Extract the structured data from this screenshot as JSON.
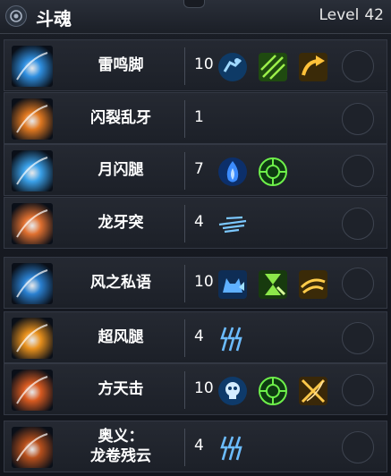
{
  "header": {
    "title": "斗魂",
    "level_label": "Level",
    "level_value": "42"
  },
  "skills": [
    {
      "name": "雷鸣脚",
      "level": "10",
      "icon": "lightning-kick-skill-icon",
      "color": "#2f8fe0",
      "passives": [
        "dash-icon",
        "triple-slash-icon",
        "arrow-curve-icon"
      ]
    },
    {
      "name": "闪裂乱牙",
      "level": "1",
      "icon": "flash-fang-skill-icon",
      "color": "#e07820",
      "passives": []
    },
    {
      "name": "月闪腿",
      "level": "7",
      "icon": "moon-flash-kick-skill-icon",
      "color": "#3aa0e8",
      "passives": [
        "blue-flame-icon",
        "crosshair-icon"
      ]
    },
    {
      "name": "龙牙突",
      "level": "4",
      "icon": "dragon-fang-thrust-skill-icon",
      "color": "#e07030",
      "passives": [
        "speed-lines-icon"
      ]
    },
    {
      "name": "风之私语",
      "level": "10",
      "icon": "wind-whisper-skill-icon",
      "color": "#2a80d0",
      "passives": [
        "cat-buff-icon",
        "hourglass-icon",
        "wind-swirl-icon"
      ]
    },
    {
      "name": "超风腿",
      "level": "4",
      "icon": "super-wind-kick-skill-icon",
      "color": "#e8901c",
      "passives": [
        "triple-lightning-icon"
      ]
    },
    {
      "name": "方天击",
      "level": "10",
      "icon": "heaven-strike-skill-icon",
      "color": "#d85a20",
      "passives": [
        "skull-burst-icon",
        "crosshair-icon",
        "cross-slash-icon"
      ]
    },
    {
      "name": "奥义：",
      "name2": "龙卷残云",
      "level": "4",
      "icon": "tornado-ultimate-skill-icon",
      "color": "#b8501c",
      "passives": [
        "triple-lightning-icon"
      ]
    }
  ]
}
